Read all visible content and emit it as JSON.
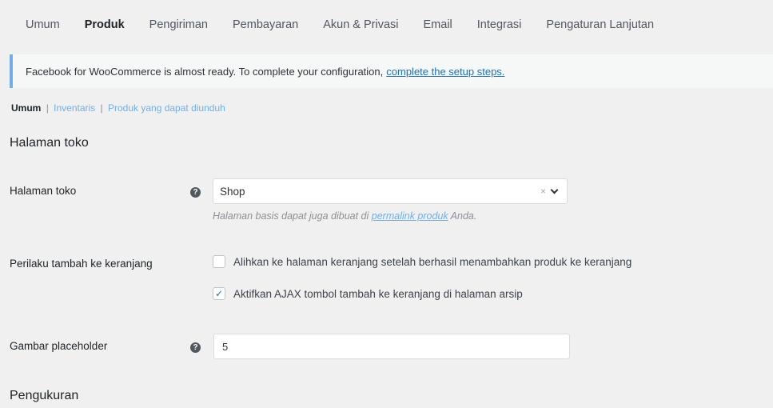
{
  "tabs": [
    {
      "label": "Umum",
      "active": false
    },
    {
      "label": "Produk",
      "active": true
    },
    {
      "label": "Pengiriman",
      "active": false
    },
    {
      "label": "Pembayaran",
      "active": false
    },
    {
      "label": "Akun & Privasi",
      "active": false
    },
    {
      "label": "Email",
      "active": false
    },
    {
      "label": "Integrasi",
      "active": false
    },
    {
      "label": "Pengaturan Lanjutan",
      "active": false
    }
  ],
  "notice": {
    "text": "Facebook for WooCommerce is almost ready. To complete your configuration,",
    "link": "complete the setup steps."
  },
  "subnav": {
    "current": "Umum",
    "links": [
      "Inventaris",
      "Produk yang dapat diunduh"
    ],
    "separator": "|"
  },
  "sections": {
    "shop_page_title": "Halaman toko",
    "measurements_title": "Pengukuran"
  },
  "shop_page": {
    "label": "Halaman toko",
    "help_icon": "?",
    "selected": "Shop",
    "clear_icon": "×",
    "desc_before": "Halaman basis dapat juga dibuat di",
    "desc_link": "permalink produk",
    "desc_after": "Anda."
  },
  "cart_behavior": {
    "label": "Perilaku tambah ke keranjang",
    "options": [
      {
        "label": "Alihkan ke halaman keranjang setelah berhasil menambahkan produk ke keranjang",
        "checked": false
      },
      {
        "label": "Aktifkan AJAX tombol tambah ke keranjang di halaman arsip",
        "checked": true
      }
    ]
  },
  "placeholder_image": {
    "label": "Gambar placeholder",
    "help_icon": "?",
    "value": "5"
  },
  "colors": {
    "accent": "#2271b1",
    "notice_border": "#72aee6",
    "background": "#f0f0f1"
  }
}
